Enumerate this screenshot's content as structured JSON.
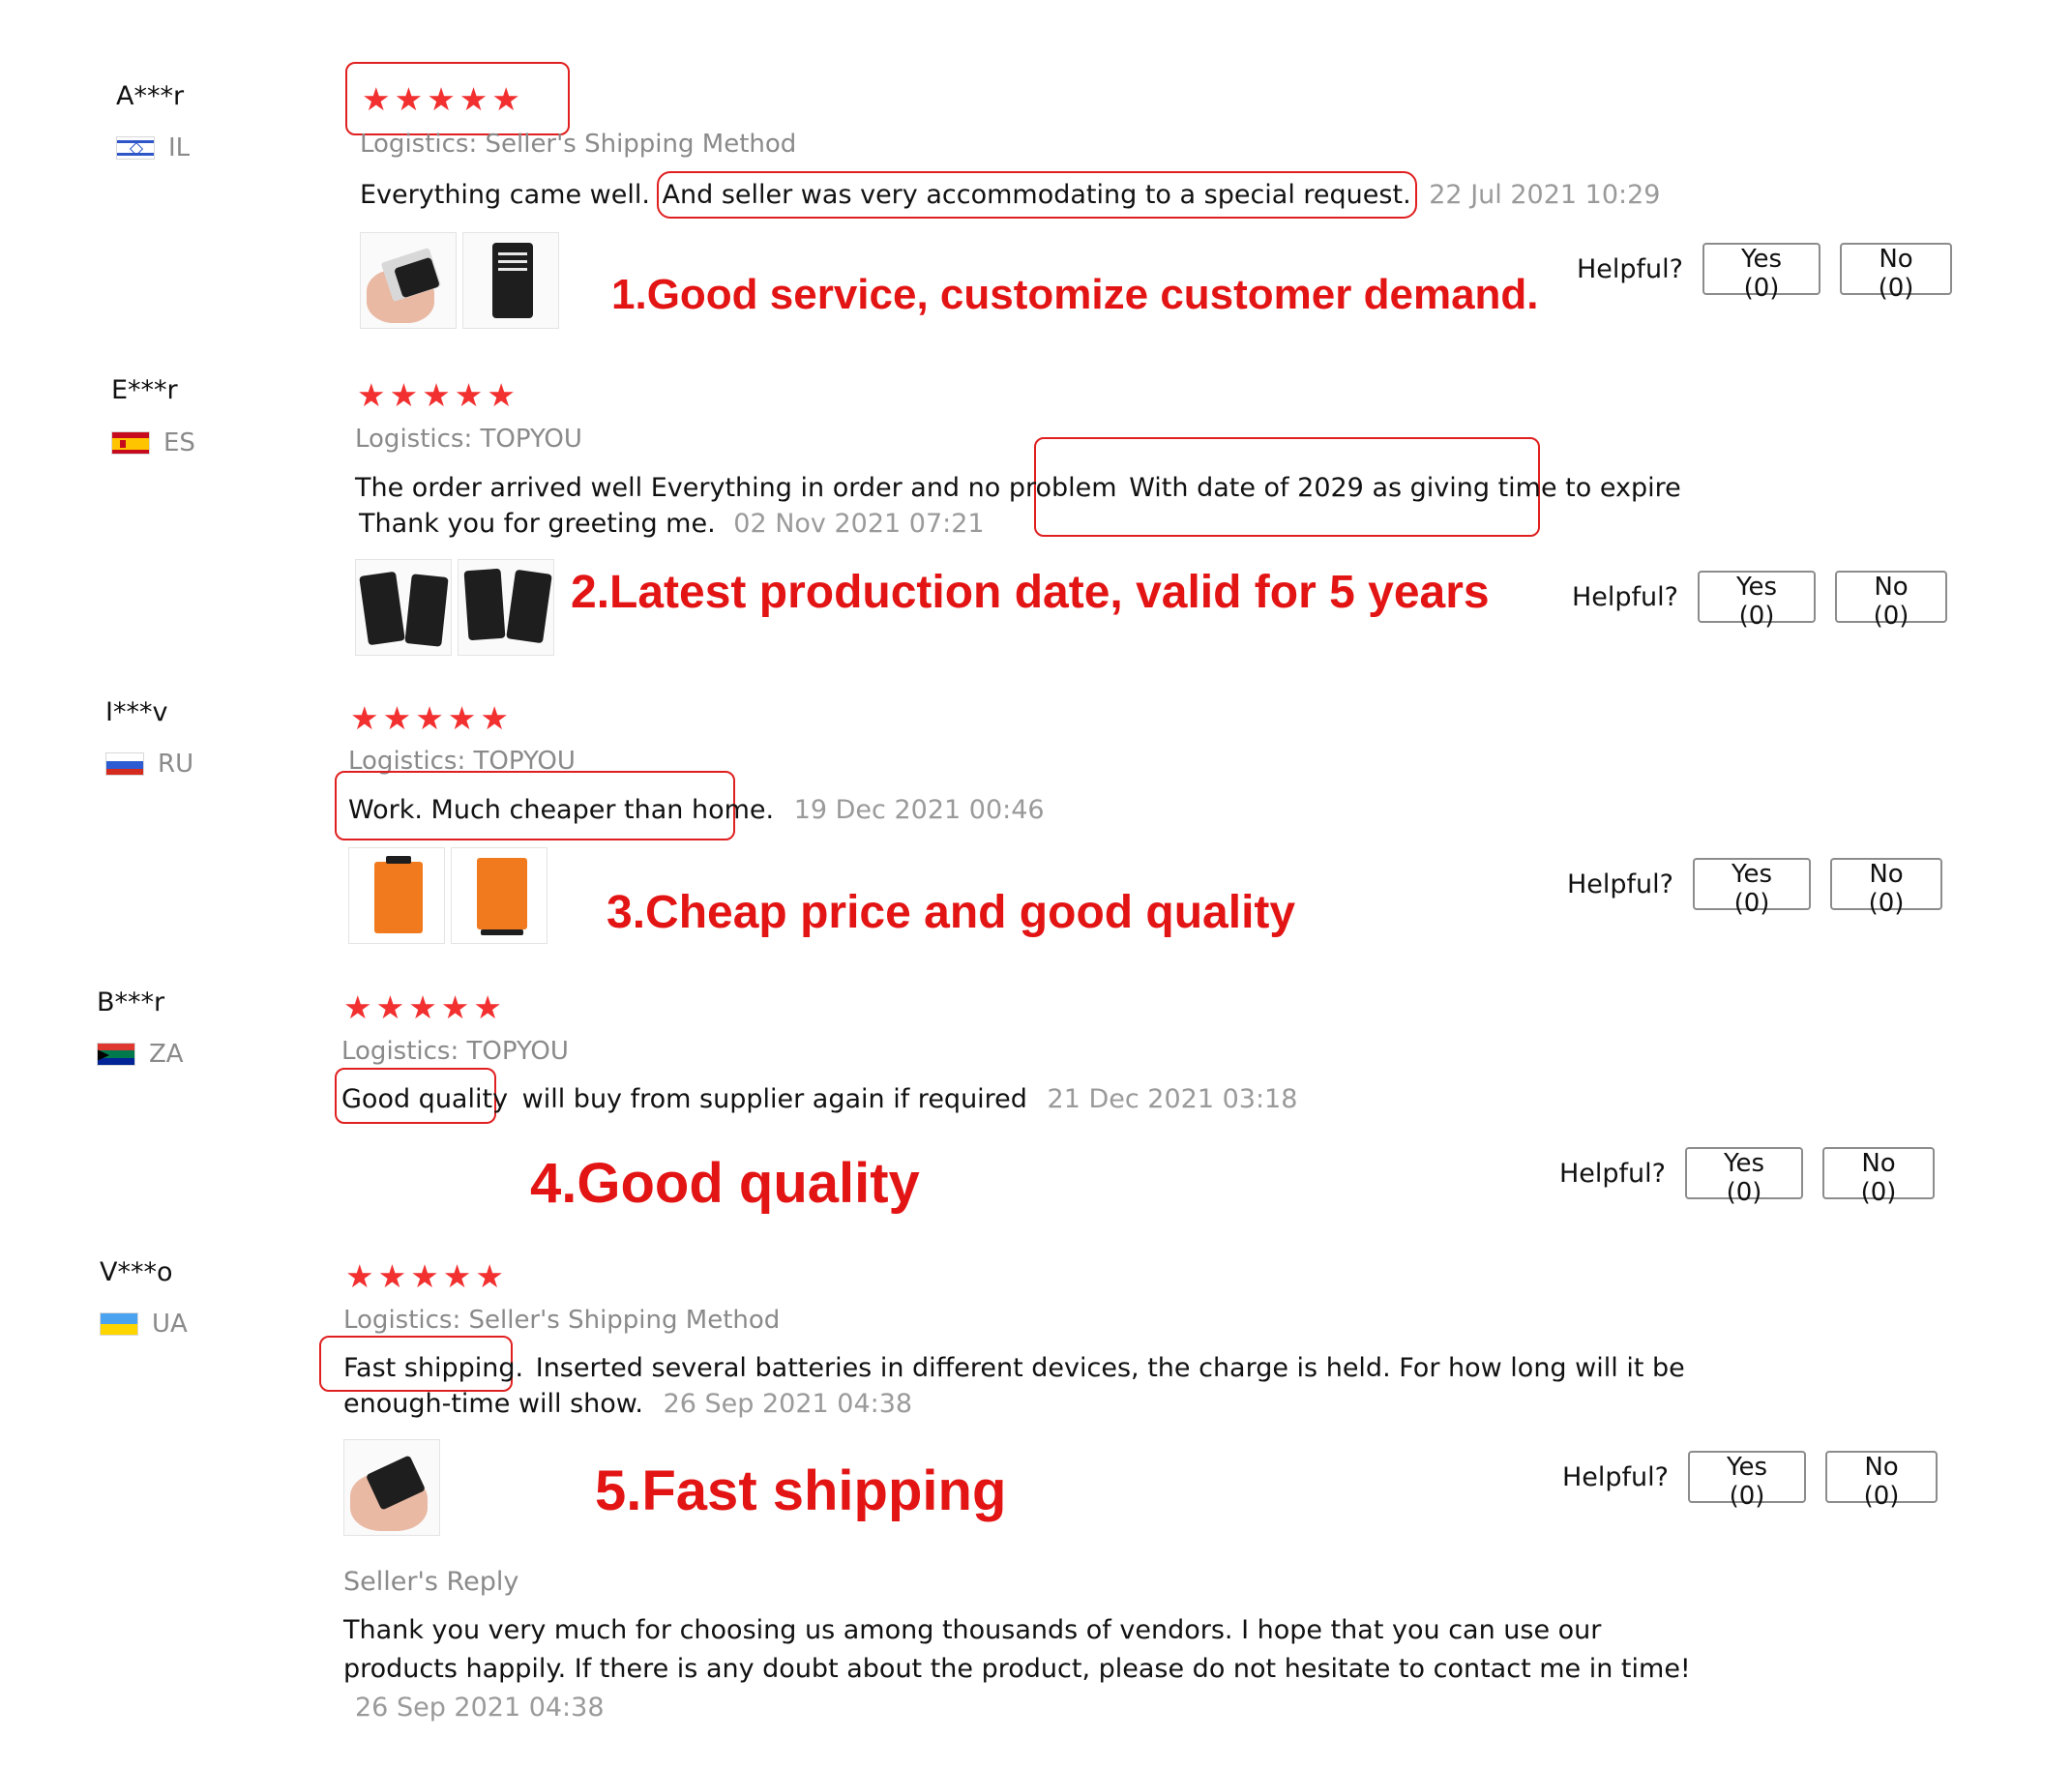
{
  "reviews": [
    {
      "reviewer": "A***r",
      "country": "IL",
      "stars": 5,
      "logistics": "Logistics: Seller's Shipping Method",
      "text_before": "Everything came well.",
      "text_highlight": "And seller was very accommodating to a special request.",
      "text_after": "",
      "date": "22 Jul 2021 10:29",
      "annotation": "1.Good service, customize customer demand.",
      "helpful_label": "Helpful?",
      "yes_label": "Yes (0)",
      "no_label": "No (0)"
    },
    {
      "reviewer": "E***r",
      "country": "ES",
      "stars": 5,
      "logistics": "Logistics: TOPYOU",
      "text_before": "The order arrived well Everything in order and no problem",
      "text_highlight": "With date of 2029 as giving time to expire",
      "text_after": "Thank you for greeting me.",
      "date": "02 Nov 2021 07:21",
      "annotation": "2.Latest production date, valid for 5 years",
      "helpful_label": "Helpful?",
      "yes_label": "Yes (0)",
      "no_label": "No (0)"
    },
    {
      "reviewer": "I***v",
      "country": "RU",
      "stars": 5,
      "logistics": "Logistics: TOPYOU",
      "text_before": "",
      "text_highlight": "Work. Much cheaper than home.",
      "text_after": "",
      "date": "19 Dec 2021 00:46",
      "annotation": "3.Cheap price and good quality",
      "helpful_label": "Helpful?",
      "yes_label": "Yes (0)",
      "no_label": "No (0)"
    },
    {
      "reviewer": "B***r",
      "country": "ZA",
      "stars": 5,
      "logistics": "Logistics: TOPYOU",
      "text_before": "",
      "text_highlight": "Good quality",
      "text_after": "will buy from supplier again if required",
      "date": "21 Dec 2021 03:18",
      "annotation": "4.Good quality",
      "helpful_label": "Helpful?",
      "yes_label": "Yes (0)",
      "no_label": "No (0)"
    },
    {
      "reviewer": "V***o",
      "country": "UA",
      "stars": 5,
      "logistics": "Logistics: Seller's Shipping Method",
      "text_before": "",
      "text_highlight": "Fast shipping.",
      "text_after": "Inserted several batteries in different devices, the charge is held. For how long will it be enough-time will show.",
      "date": "26 Sep 2021 04:38",
      "annotation": "5.Fast shipping",
      "helpful_label": "Helpful?",
      "yes_label": "Yes (0)",
      "no_label": "No (0)",
      "seller_reply_label": "Seller's Reply",
      "seller_reply_text": "Thank you very much for choosing us among thousands of vendors. I hope that you can use our products happily. If there is any doubt about the product, please do not hesitate to contact me in time!",
      "seller_reply_date": "26 Sep 2021 04:38"
    }
  ],
  "colors": {
    "star": "#f23030",
    "annotation": "#e31414",
    "highlight_box": "#e02020",
    "muted_text": "#8a8a8a"
  }
}
